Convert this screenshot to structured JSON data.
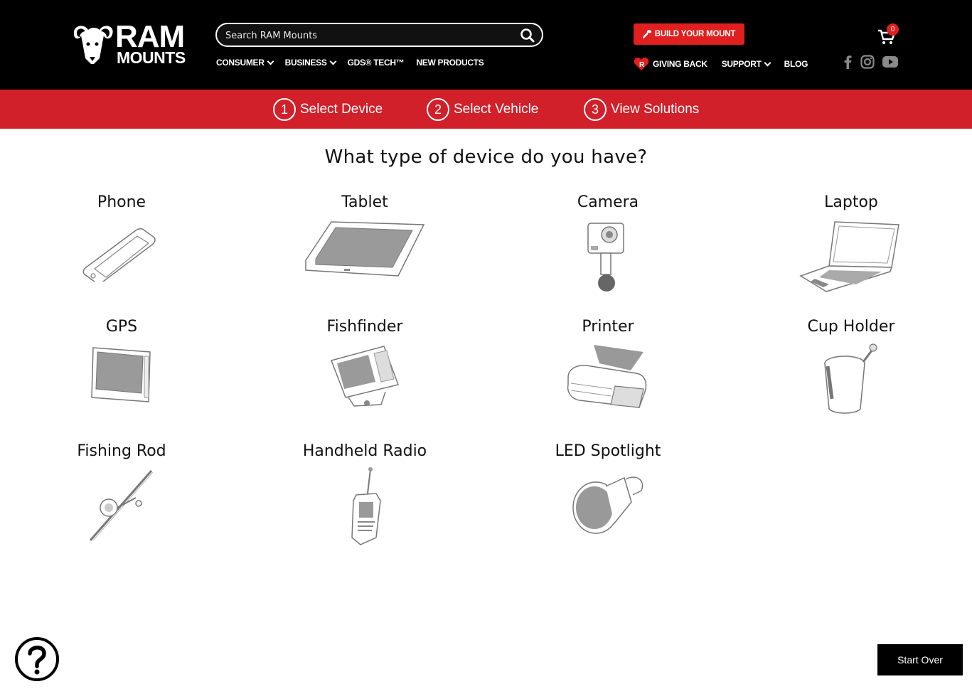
{
  "header": {
    "logo_line1": "RAM",
    "logo_line2": "MOUNTS",
    "search_placeholder": "Search RAM Mounts",
    "nav": [
      {
        "label": "CONSUMER",
        "dropdown": true
      },
      {
        "label": "BUSINESS",
        "dropdown": true
      },
      {
        "label": "GDS® TECH™",
        "dropdown": false
      },
      {
        "label": "NEW PRODUCTS",
        "dropdown": false
      }
    ],
    "build_button": "BUILD YOUR MOUNT",
    "secondary_nav": [
      {
        "label": "GIVING BACK",
        "icon": "heart-logo-icon"
      },
      {
        "label": "SUPPORT",
        "dropdown": true
      },
      {
        "label": "BLOG"
      }
    ],
    "cart_count": "0",
    "social": [
      "facebook-icon",
      "instagram-icon",
      "youtube-icon"
    ]
  },
  "steps": [
    {
      "number": "1",
      "label": "Select Device"
    },
    {
      "number": "2",
      "label": "Select Vehicle"
    },
    {
      "number": "3",
      "label": "View Solutions"
    }
  ],
  "question": "What type of device do you have?",
  "devices": [
    {
      "label": "Phone",
      "icon": "phone-icon"
    },
    {
      "label": "Tablet",
      "icon": "tablet-icon"
    },
    {
      "label": "Camera",
      "icon": "camera-icon"
    },
    {
      "label": "Laptop",
      "icon": "laptop-icon"
    },
    {
      "label": "GPS",
      "icon": "gps-icon"
    },
    {
      "label": "Fishfinder",
      "icon": "fishfinder-icon"
    },
    {
      "label": "Printer",
      "icon": "printer-icon"
    },
    {
      "label": "Cup Holder",
      "icon": "cup-holder-icon"
    },
    {
      "label": "Fishing Rod",
      "icon": "fishing-rod-icon"
    },
    {
      "label": "Handheld Radio",
      "icon": "handheld-radio-icon"
    },
    {
      "label": "LED Spotlight",
      "icon": "led-spotlight-icon"
    }
  ],
  "start_over": "Start Over",
  "colors": {
    "brand_red": "#d1202a",
    "button_red": "#e0201f",
    "black": "#000000"
  }
}
